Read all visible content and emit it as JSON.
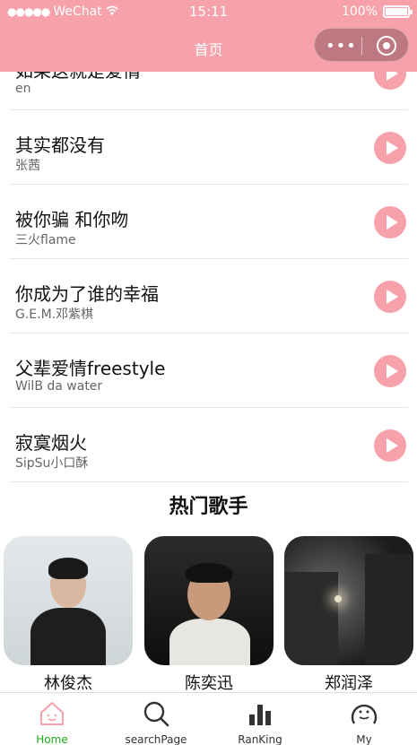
{
  "status_bar": {
    "signal": "●●●●●",
    "carrier": "WeChat",
    "time": "15:11",
    "battery": "100%",
    "battery_level": 1.0
  },
  "nav": {
    "title": "首页",
    "more": "•••"
  },
  "songs": [
    {
      "title": "如果这就是爱情",
      "artist": "en"
    },
    {
      "title": "其实都没有",
      "artist": "张茜"
    },
    {
      "title": "被你骗 和你吻",
      "artist": "三火flame"
    },
    {
      "title": "你成为了谁的幸福",
      "artist": "G.E.M.邓紫棋"
    },
    {
      "title": "父辈爱情freestyle",
      "artist": "WilB da water"
    },
    {
      "title": "寂寞烟火",
      "artist": "SipSu小口酥"
    }
  ],
  "hot_singers": {
    "title": "热门歌手",
    "items": [
      {
        "name": "林俊杰"
      },
      {
        "name": "陈奕迅"
      },
      {
        "name": "郑润泽"
      }
    ]
  },
  "tabbar": {
    "items": [
      {
        "label": "Home",
        "icon": "home-icon",
        "active": true
      },
      {
        "label": "searchPage",
        "icon": "search-icon",
        "active": false
      },
      {
        "label": "RanKing",
        "icon": "ranking-icon",
        "active": false
      },
      {
        "label": "My",
        "icon": "my-icon",
        "active": false
      }
    ],
    "active_color": "#1aad19"
  },
  "colors": {
    "accent": "#f7a1ab"
  }
}
